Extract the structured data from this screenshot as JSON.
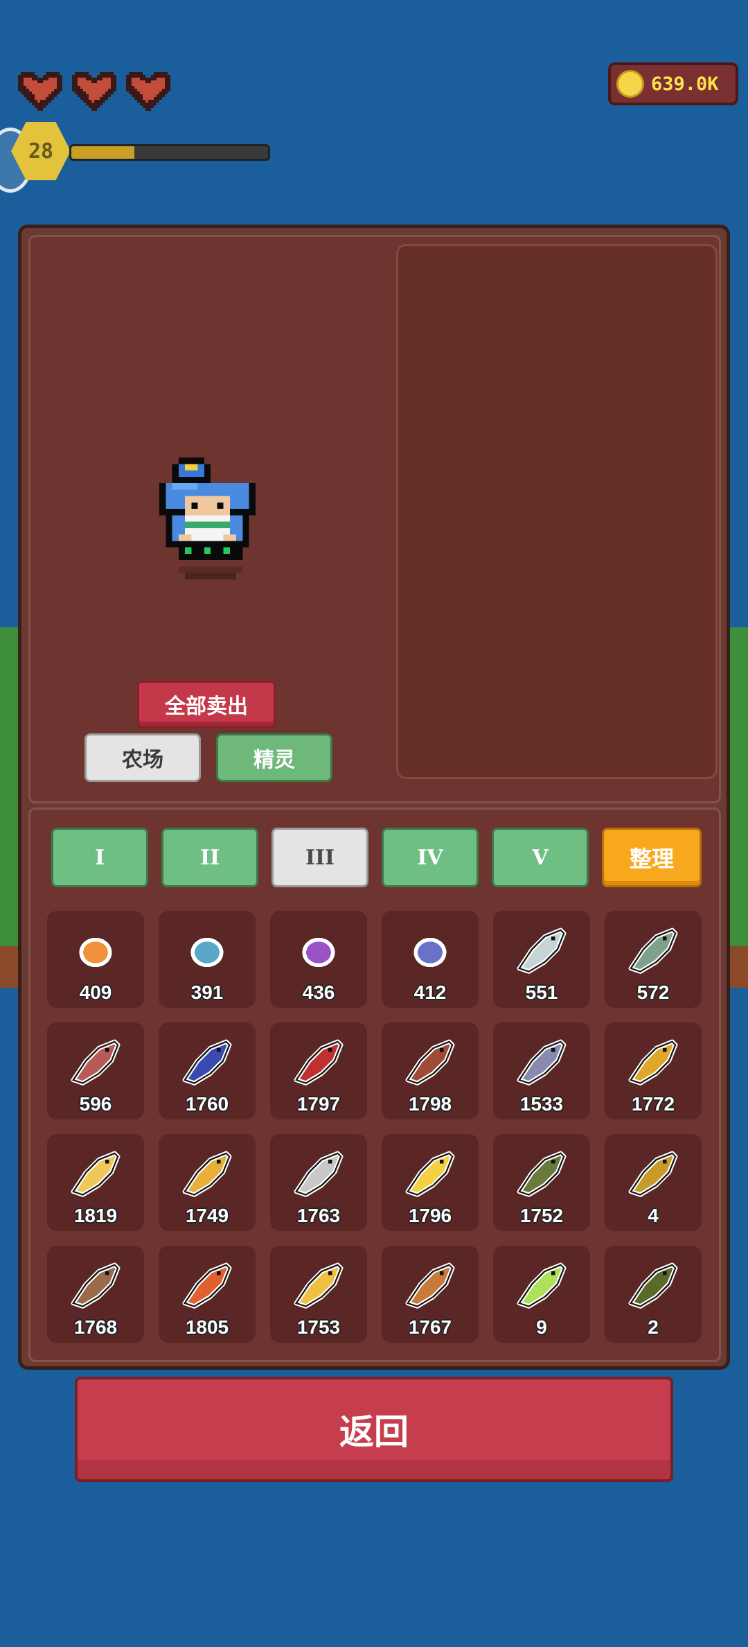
{
  "hud": {
    "hearts": 3,
    "level": "28",
    "xp_fraction": 0.32,
    "coins": "639.0K"
  },
  "panel": {
    "sell_all_label": "全部卖出",
    "tabs": [
      {
        "label": "农场",
        "active": true
      },
      {
        "label": "精灵",
        "active": false
      }
    ],
    "tiers": [
      {
        "label": "I",
        "active": false
      },
      {
        "label": "II",
        "active": false
      },
      {
        "label": "III",
        "active": true
      },
      {
        "label": "IV",
        "active": false
      },
      {
        "label": "V",
        "active": false
      }
    ],
    "sort_label": "整理",
    "items": [
      {
        "icon": "orange-seed-icon",
        "count": "409",
        "color": "#f2913a"
      },
      {
        "icon": "blue-gem-icon",
        "count": "391",
        "color": "#5aa7c9"
      },
      {
        "icon": "purple-gem-icon",
        "count": "436",
        "color": "#9a52c4"
      },
      {
        "icon": "blue-pebble-icon",
        "count": "412",
        "color": "#6a72c8"
      },
      {
        "icon": "white-shell-icon",
        "count": "551",
        "color": "#c8d4d4"
      },
      {
        "icon": "green-seaweed-icon",
        "count": "572",
        "color": "#7fa08a"
      },
      {
        "icon": "red-coral-icon",
        "count": "596",
        "color": "#b85a5a"
      },
      {
        "icon": "blue-fish-icon",
        "count": "1760",
        "color": "#3a4ab0"
      },
      {
        "icon": "red-fish-icon",
        "count": "1797",
        "color": "#c03030"
      },
      {
        "icon": "striped-fish-icon",
        "count": "1798",
        "color": "#a04a38"
      },
      {
        "icon": "grey-fish-icon",
        "count": "1533",
        "color": "#8a8ab0"
      },
      {
        "icon": "yellow-fish-icon",
        "count": "1772",
        "color": "#e0a82a"
      },
      {
        "icon": "gold-fish-icon",
        "count": "1819",
        "color": "#f0c85a"
      },
      {
        "icon": "golden-fish-icon",
        "count": "1749",
        "color": "#e8b03a"
      },
      {
        "icon": "silver-fish-icon",
        "count": "1763",
        "color": "#c8c8c8"
      },
      {
        "icon": "sun-fish-icon",
        "count": "1796",
        "color": "#f4d042"
      },
      {
        "icon": "green-eel-icon",
        "count": "1752",
        "color": "#6a7a3a"
      },
      {
        "icon": "tropical-fish-icon",
        "count": "4",
        "color": "#c89a2a"
      },
      {
        "icon": "brown-flounder-icon",
        "count": "1768",
        "color": "#9a6a4a"
      },
      {
        "icon": "clownfish-icon",
        "count": "1805",
        "color": "#e06030"
      },
      {
        "icon": "yellow-tang-icon",
        "count": "1753",
        "color": "#f0c040"
      },
      {
        "icon": "lionfish-icon",
        "count": "1767",
        "color": "#c87a3a"
      },
      {
        "icon": "lime-fish-icon",
        "count": "9",
        "color": "#b0e05a"
      },
      {
        "icon": "dark-bass-icon",
        "count": "2",
        "color": "#5a6a2a"
      }
    ]
  },
  "back_label": "返回"
}
